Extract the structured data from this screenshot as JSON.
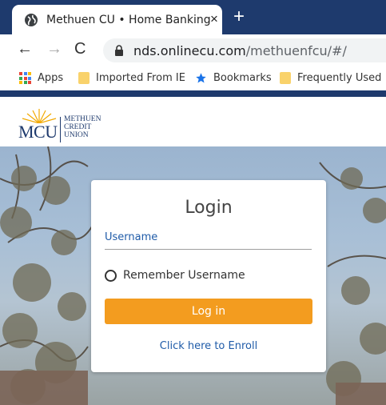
{
  "browser": {
    "tab": {
      "title": "Methuen CU • Home Banking",
      "close_glyph": "×",
      "favicon": "globe-icon"
    },
    "new_tab_glyph": "+",
    "nav": {
      "back_glyph": "←",
      "forward_glyph": "→",
      "reload_glyph": "C"
    },
    "address": {
      "host": "nds.onlinecu.com",
      "path": "/methuenfcu/#/"
    },
    "bookmarks": [
      {
        "label": "Apps",
        "icon": "apps-grid-icon"
      },
      {
        "label": "Imported From IE",
        "icon": "folder-icon"
      },
      {
        "label": "Bookmarks",
        "icon": "star-icon"
      },
      {
        "label": "Frequently Used",
        "icon": "folder-icon"
      }
    ],
    "accent": "#1e3a6d"
  },
  "site": {
    "logo": {
      "mark": "MCU",
      "line1": "METHUEN",
      "line2": "CREDIT",
      "line3": "UNION"
    }
  },
  "login": {
    "title": "Login",
    "username_label": "Username",
    "username_value": "",
    "remember_label": "Remember Username",
    "remember_checked": false,
    "button_label": "Log in",
    "enroll_link": "Click here to Enroll",
    "button_color": "#f39c1f",
    "link_color": "#1f5ba8"
  }
}
